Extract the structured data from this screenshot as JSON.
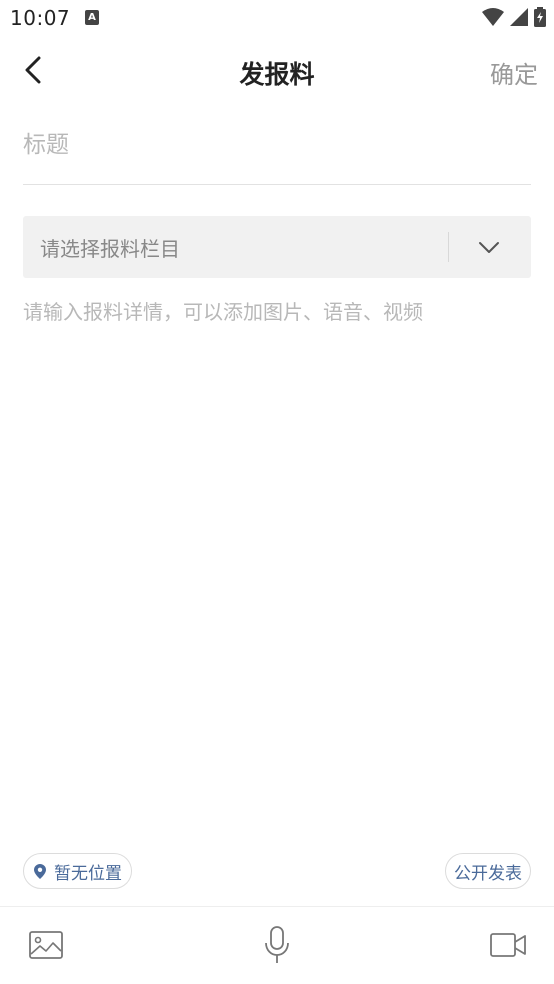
{
  "status_bar": {
    "time": "10:07",
    "notification_letter": "A"
  },
  "nav": {
    "title": "发报料",
    "confirm_label": "确定"
  },
  "form": {
    "title_placeholder": "标题",
    "category_placeholder": "请选择报料栏目",
    "detail_placeholder": "请输入报料详情，可以添加图片、语音、视频"
  },
  "chips": {
    "location_label": "暂无位置",
    "publish_label": "公开发表"
  },
  "icons": {
    "back": "chevron-left-icon",
    "dropdown": "chevron-down-icon",
    "location": "location-pin-icon",
    "image": "image-icon",
    "voice": "microphone-icon",
    "video": "video-camera-icon"
  },
  "colors": {
    "accent_blue": "#4a6a9a",
    "placeholder": "#b8b8b8",
    "select_bg": "#f1f1f1"
  }
}
